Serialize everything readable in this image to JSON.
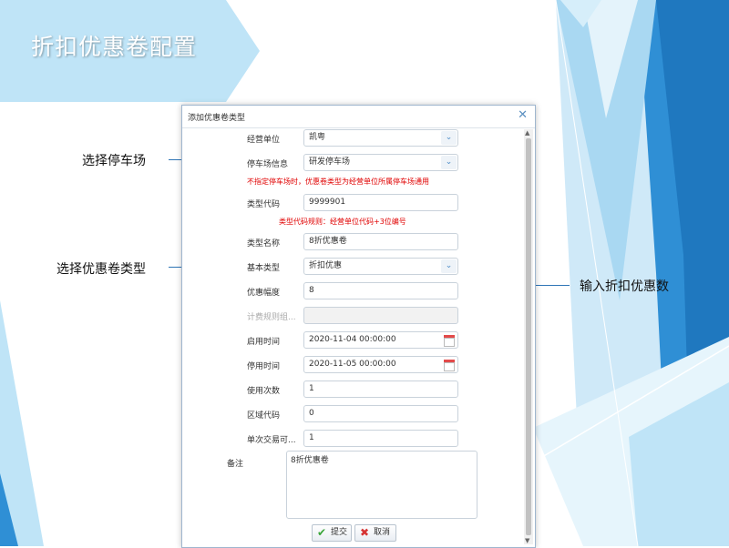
{
  "slide": {
    "title": "折扣优惠卷配置",
    "colors": {
      "primary_blue": "#2f8fd5",
      "light_blue": "#bfe4f7",
      "accent_teal": "#1f6f8b",
      "hint_red": "#e00000"
    }
  },
  "callouts": {
    "parking": "选择停车场",
    "coupon_type": "选择优惠卷类型",
    "discount": "输入折扣优惠数"
  },
  "dialog": {
    "title": "添加优惠卷类型",
    "close_icon": "close-icon",
    "fields": {
      "operator": {
        "label": "经营单位",
        "value": "凯粤"
      },
      "parking": {
        "label": "停车场信息",
        "value": "研发停车场"
      },
      "parking_hint": "不指定停车场时，优惠卷类型为经营单位所属停车场通用",
      "type_code": {
        "label": "类型代码",
        "value": "9999901"
      },
      "type_code_hint": "类型代码规则：经营单位代码+3位编号",
      "type_name": {
        "label": "类型名称",
        "value": "8折优惠卷"
      },
      "base_type": {
        "label": "基本类型",
        "value": "折扣优惠"
      },
      "discount": {
        "label": "优惠幅度",
        "value": "8"
      },
      "billing_rule": {
        "label": "计费规则组...",
        "value": ""
      },
      "start_time": {
        "label": "启用时间",
        "value": "2020-11-04 00:00:00"
      },
      "stop_time": {
        "label": "停用时间",
        "value": "2020-11-05 00:00:00"
      },
      "use_count": {
        "label": "使用次数",
        "value": "1"
      },
      "area_code": {
        "label": "区域代码",
        "value": "0"
      },
      "single_trade": {
        "label": "单次交易可...",
        "value": "1"
      },
      "remark": {
        "label": "备注",
        "value": "8折优惠卷"
      }
    },
    "buttons": {
      "submit": "提交",
      "cancel": "取消"
    }
  }
}
